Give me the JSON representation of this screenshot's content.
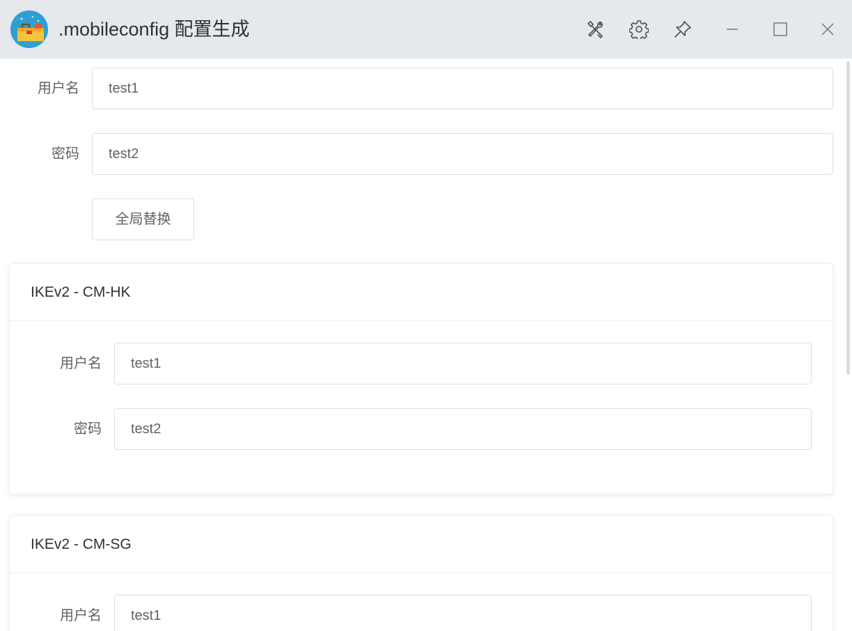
{
  "window": {
    "title": ".mobileconfig 配置生成",
    "logo_icon": "toolbox-app-icon",
    "controls": {
      "tools_icon": "tools-icon",
      "settings_icon": "gear-icon",
      "pin_icon": "pin-icon",
      "minimize_icon": "minimize-icon",
      "maximize_icon": "maximize-icon",
      "close_icon": "close-icon"
    }
  },
  "global": {
    "username_label": "用户名",
    "username_value": "test1",
    "password_label": "密码",
    "password_value": "test2",
    "replace_button": "全局替换"
  },
  "profiles": [
    {
      "title": "IKEv2 - CM-HK",
      "username_label": "用户名",
      "username_value": "test1",
      "password_label": "密码",
      "password_value": "test2"
    },
    {
      "title": "IKEv2 - CM-SG",
      "username_label": "用户名",
      "username_value": "test1"
    }
  ],
  "colors": {
    "titlebar_bg": "#e5e8ec",
    "border": "#dcdfe6",
    "text_primary": "#303133",
    "text_regular": "#606266"
  }
}
